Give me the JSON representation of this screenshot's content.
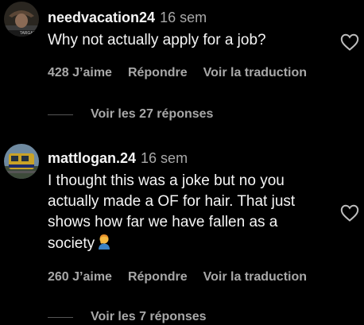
{
  "comments": [
    {
      "username": "needvacation24",
      "time": "16 sem",
      "text": "Why not actually apply for a job?",
      "likes": "428 J’aime",
      "reply_label": "Répondre",
      "translate_label": "Voir la traduction",
      "view_replies": "Voir les 27 réponses",
      "avatar_text": "TARGAR"
    },
    {
      "username": "mattlogan.24",
      "time": "16 sem",
      "text_lines": [
        "I thought this was a joke but no you",
        "actually made a OF for hair. That just",
        "shows how far we have fallen as a",
        "society"
      ],
      "emoji": "person-facepalming-emoji",
      "likes": "260 J’aime",
      "reply_label": "Répondre",
      "translate_label": "Voir la traduction",
      "view_replies": "Voir les 7 réponses"
    }
  ],
  "colors": {
    "background": "#000000",
    "primary_text": "#f5f5f5",
    "secondary_text": "#a8a8a8",
    "divider": "#555555"
  },
  "icons": {
    "like": "heart-outline-icon"
  }
}
